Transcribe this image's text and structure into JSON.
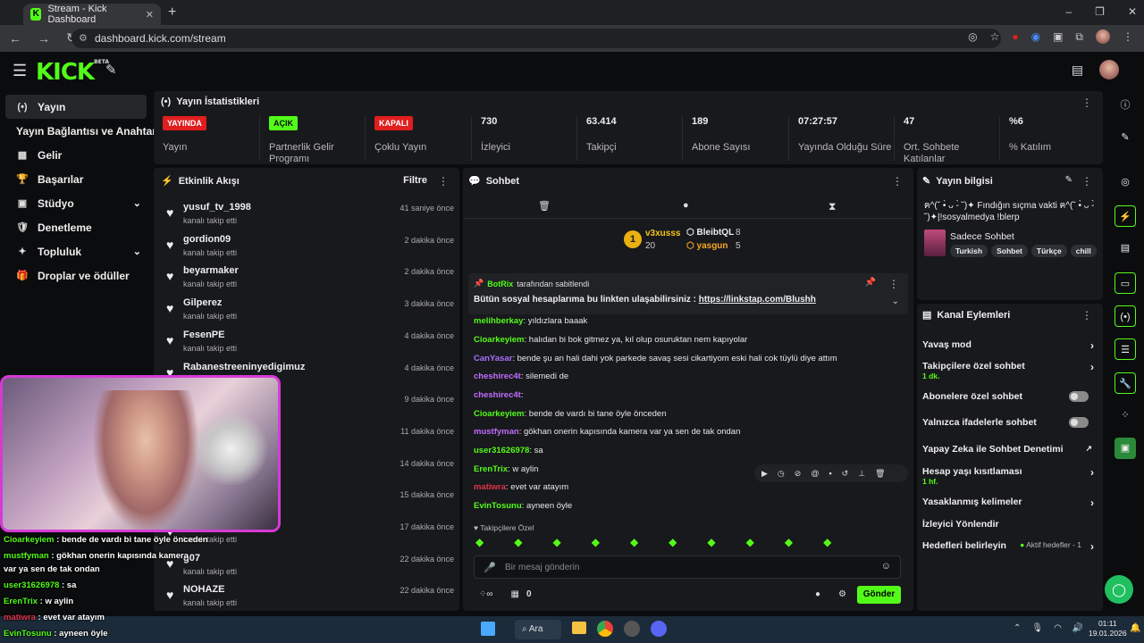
{
  "browser": {
    "tab_title": "Stream - Kick Dashboard",
    "tab_close": "✕",
    "new_tab": "+",
    "url": "dashboard.kick.com/stream",
    "window_controls": [
      "–",
      "❐",
      "✕"
    ],
    "nav": [
      "←",
      "→",
      "↻"
    ]
  },
  "header": {
    "logo": "KICK",
    "logo_beta": "BETA"
  },
  "nav": {
    "items": [
      {
        "icon": "(•)",
        "label": "Yayın"
      },
      {
        "icon": "",
        "label": "Yayın Bağlantısı ve Anahtarı"
      },
      {
        "icon": "▦",
        "label": "Gelir"
      },
      {
        "icon": "🏆",
        "label": "Başarılar"
      },
      {
        "icon": "▣",
        "label": "Stüdyo",
        "chev": "⌄"
      },
      {
        "icon": "🛡",
        "label": "Denetleme"
      },
      {
        "icon": "✦",
        "label": "Topluluk",
        "chev": "⌄"
      },
      {
        "icon": "🎁",
        "label": "Droplar ve ödüller"
      }
    ]
  },
  "stats": {
    "title": "Yayın İstatistikleri",
    "items": [
      {
        "value": "YAYINDA",
        "label": "Yayın",
        "badge_color": "#e01e1e",
        "badge_text": "#ffffff"
      },
      {
        "value": "AÇIK",
        "label": "Partnerlik Gelir Programı",
        "badge_color": "#53fc18",
        "badge_text": "#0b0c0e"
      },
      {
        "value": "KAPALI",
        "label": "Çoklu Yayın",
        "badge_color": "#e01e1e",
        "badge_text": "#ffffff"
      },
      {
        "value": "730",
        "label": "İzleyici"
      },
      {
        "value": "63.414",
        "label": "Takipçi"
      },
      {
        "value": "189",
        "label": "Abone Sayısı"
      },
      {
        "value": "07:27:57",
        "label": "Yayında Olduğu Süre"
      },
      {
        "value": "47",
        "label": "Ort. Sohbete Katılanlar"
      },
      {
        "value": "%6",
        "label": "% Katılım"
      }
    ]
  },
  "activity": {
    "title": "Etkinlik Akışı",
    "filter": "Filtre",
    "rows": [
      {
        "name": "yusuf_tv_1998",
        "sub": "kanalı takip etti",
        "time": "41 saniye önce"
      },
      {
        "name": "gordion09",
        "sub": "kanalı takip etti",
        "time": "2 dakika önce"
      },
      {
        "name": "beyarmaker",
        "sub": "kanalı takip etti",
        "time": "2 dakika önce"
      },
      {
        "name": "Gilperez",
        "sub": "kanalı takip etti",
        "time": "3 dakika önce"
      },
      {
        "name": "FesenPE",
        "sub": "kanalı takip etti",
        "time": "4 dakika önce"
      },
      {
        "name": "Rabanestreeninyedigimuz",
        "sub": "",
        "time": "4 dakika önce"
      },
      {
        "name": "",
        "sub": "",
        "time": "9 dakika önce"
      },
      {
        "name": "",
        "sub": "",
        "time": "11 dakika önce"
      },
      {
        "name": "",
        "sub": "",
        "time": "14 dakika önce"
      },
      {
        "name": "",
        "sub": "",
        "time": "15 dakika önce"
      },
      {
        "name": "",
        "sub": "kanalı takip etti",
        "time": "17 dakika önce"
      },
      {
        "name": "g07",
        "sub": "kanalı takip etti",
        "time": "22 dakika önce"
      },
      {
        "name": "NOHAZE",
        "sub": "kanalı takip etti",
        "time": "22 dakika önce"
      }
    ]
  },
  "chat": {
    "title": "Sohbet",
    "leaders": {
      "first": "v3xusss",
      "first_count": "20",
      "rank": "1",
      "second": "BleibtQL",
      "second_count": "8",
      "third": "yasgun",
      "third_count": "5"
    },
    "pinned": {
      "by": "BotRix",
      "by_suffix": "tarafından sabitlendi",
      "text": "Bütün sosyal hesaplarıma bu linkten ulaşabilirsiniz : ",
      "link": "https://linkstap.com/Blushh"
    },
    "messages": [
      {
        "user": "melihberkay",
        "color": "#53fc18",
        "text": "yıldızlara baaak"
      },
      {
        "user": "Cioarkeyiem",
        "color": "#53fc18",
        "text": "halıdan bi bok gitmez ya, kıl olup osuruktan nem kapıyolar"
      },
      {
        "user": "CanYasar",
        "color": "#a970ff",
        "text": "bende şu an hali dahi yok parkede savaş sesi cikartiyom eski hali cok tüylü diye attım"
      },
      {
        "user": "cheshirec4t",
        "color": "#c06cff",
        "text": "silemedi de"
      },
      {
        "user": "cheshirec4t",
        "color": "#c06cff",
        "text": ""
      },
      {
        "user": "Cioarkeyiem",
        "color": "#53fc18",
        "text": "bende de vardı bi tane öyle önceden"
      },
      {
        "user": "mustfyman",
        "color": "#c06cff",
        "text": "gökhan onerin kapısında kamera var ya sen de tak ondan"
      },
      {
        "user": "user31626978",
        "color": "#53fc18",
        "text": "sa"
      },
      {
        "user": "ErenTrix",
        "color": "#53fc18",
        "text": "w aylin"
      },
      {
        "user": "matiwra",
        "color": "#e0344b",
        "text": "evet var atayım"
      },
      {
        "user": "EvinTosunu",
        "color": "#53fc18",
        "text": "ayneen öyle"
      }
    ],
    "followers_only": "Takipçilere Özel",
    "input_placeholder": "Bir mesaj gönderin",
    "points": "0",
    "send": "Gönder"
  },
  "info": {
    "title": "Yayın bilgisi",
    "stream_title": "ฅ^(˘ •̀ ᴗ -̀ ˘)✦ Fındığın sıçma vakti ฅ^(˘ •̀ ᴗ -̀ ˘)✦|!sosyalmedya !blerp",
    "category": "Sadece Sohbet",
    "tags": [
      "Turkish",
      "Sohbet",
      "Türkçe",
      "chill"
    ]
  },
  "actions": {
    "title": "Kanal Eylemleri",
    "rows": [
      {
        "label": "Yavaş mod",
        "sub": "",
        "control": "chevron"
      },
      {
        "label": "Takipçilere özel sohbet",
        "sub": "1 dk.",
        "control": "chevron"
      },
      {
        "label": "Abonelere özel sohbet",
        "sub": "",
        "control": "toggle"
      },
      {
        "label": "Yalnızca ifadelerle sohbet",
        "sub": "",
        "control": "toggle"
      },
      {
        "label": "Yapay Zeka ile Sohbet Denetimi",
        "sub": "",
        "control": "link"
      },
      {
        "label": "Hesap yaşı kısıtlaması",
        "sub": "1 hf.",
        "control": "chevron"
      },
      {
        "label": "Yasaklanmış kelimeler",
        "sub": "",
        "control": "chevron"
      },
      {
        "label": "İzleyici Yönlendir",
        "sub": "",
        "control": "none"
      },
      {
        "label": "Hedefleri belirleyin",
        "sub": "Aktif hedefler - 1",
        "control": "chevron"
      }
    ]
  },
  "overlay": [
    {
      "user": "Cioarkeyiem",
      "color": "#53fc18",
      "text": " : bende de vardı bi tane öyle önceden"
    },
    {
      "user": "mustfyman",
      "color": "#53fc18",
      "text": " : gökhan onerin kapısında kamera"
    },
    {
      "user": "",
      "color": "#ffffff",
      "text": "var ya sen de tak ondan"
    },
    {
      "user": "user31626978",
      "color": "#53fc18",
      "text": " : sa"
    },
    {
      "user": "ErenTrix",
      "color": "#53fc18",
      "text": " : w aylin"
    },
    {
      "user": "matiwra",
      "color": "#e0344b",
      "text": " : evet var atayım"
    },
    {
      "user": "EvinTosunu",
      "color": "#53fc18",
      "text": " : ayneen öyle"
    }
  ],
  "taskbar": {
    "search": "Ara",
    "time": "01:11",
    "date": "19.01.2026"
  },
  "colors": {
    "accent": "#53fc18",
    "panel": "#18191c",
    "background": "#0b0c0e"
  }
}
